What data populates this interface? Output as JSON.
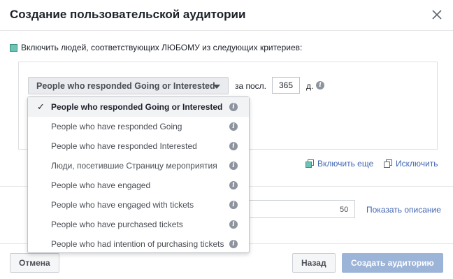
{
  "dialog": {
    "title": "Создание пользовательской аудитории",
    "close_icon": "close-icon"
  },
  "include_rule": {
    "label": "Включить людей, соответствующих ЛЮБОМУ из следующих критериев:",
    "swatch_color": "#6bc4b4"
  },
  "rule": {
    "selected": "People who responded Going or Interested",
    "within_label": "за посл.",
    "days_value": "365",
    "days_unit": "д."
  },
  "dropdown": {
    "items": [
      {
        "label": "People who responded Going or Interested",
        "selected": true
      },
      {
        "label": "People who have responded Going"
      },
      {
        "label": "People who have responded Interested"
      },
      {
        "label": "Люди, посетившие Страницу мероприятия"
      },
      {
        "label": "People who have engaged"
      },
      {
        "label": "People who have engaged with tickets"
      },
      {
        "label": "People who have purchased tickets"
      },
      {
        "label": "People who had intention of purchasing tickets"
      }
    ]
  },
  "links": {
    "include_more": "Включить еще",
    "exclude": "Исключить"
  },
  "name_field": {
    "char_count": "50",
    "show_description": "Показать описание"
  },
  "footer": {
    "cancel": "Отмена",
    "back": "Назад",
    "create": "Создать аудиторию"
  },
  "colors": {
    "link": "#4267b2",
    "primary_disabled": "#9cb4d8"
  }
}
